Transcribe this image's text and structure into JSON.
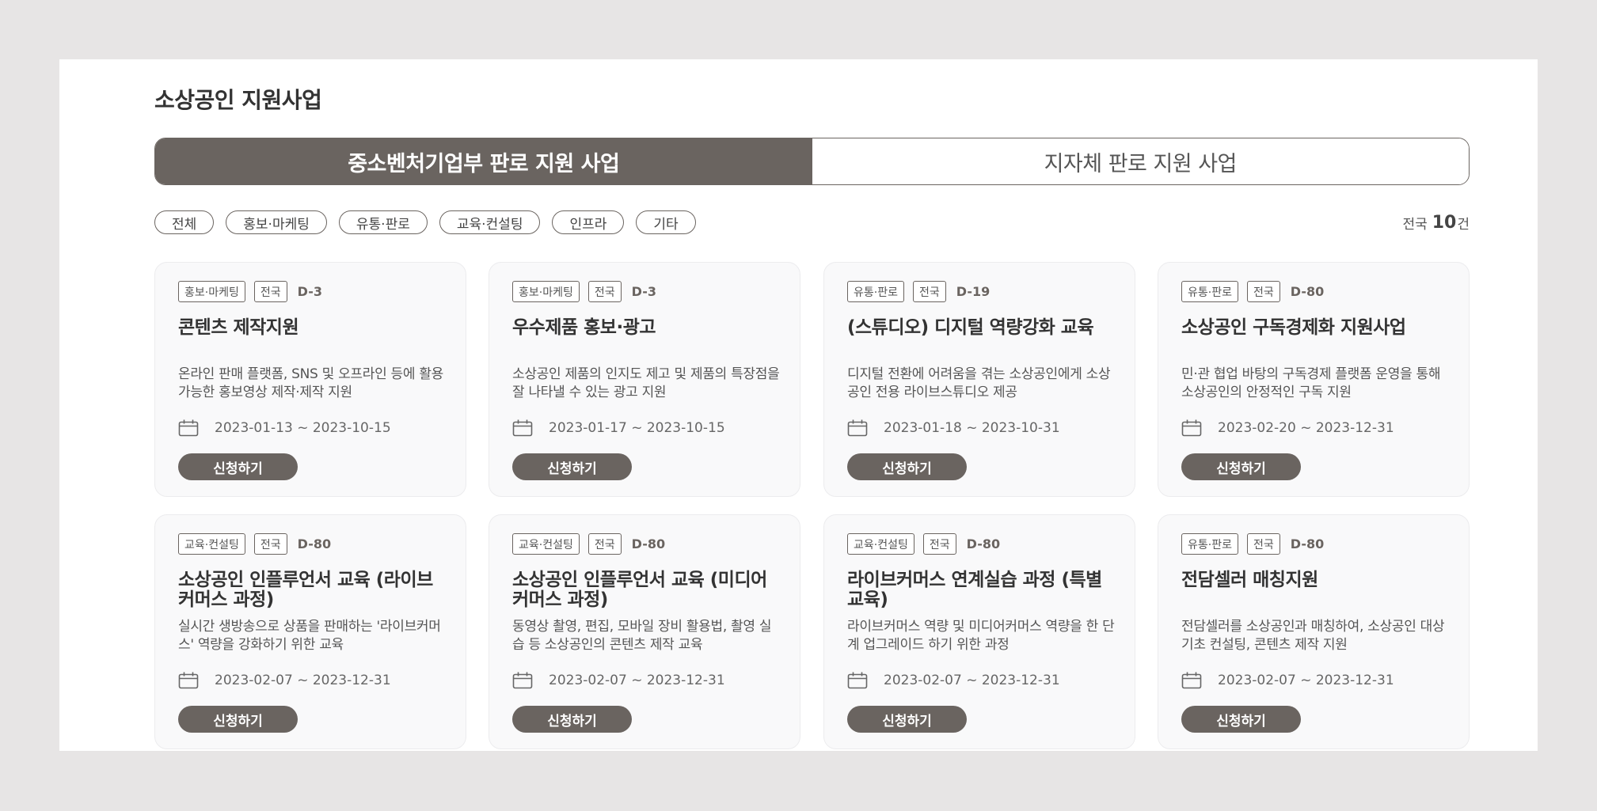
{
  "page": {
    "title": "소상공인 지원사업"
  },
  "tabs": [
    {
      "label": "중소벤처기업부 판로 지원 사업",
      "active": true
    },
    {
      "label": "지자체 판로 지원 사업",
      "active": false
    }
  ],
  "filters": [
    "전체",
    "홍보·마케팅",
    "유통·판로",
    "교육·컨설팅",
    "인프라",
    "기타"
  ],
  "count": {
    "prefix": "전국",
    "number": "10",
    "suffix": "건"
  },
  "apply_label": "신청하기",
  "colors": {
    "accent": "#6a6460",
    "card_bg": "#f9f9fa",
    "page_bg": "#e7e5e5"
  },
  "cards": [
    {
      "category": "홍보·마케팅",
      "region": "전국",
      "dday": "D-3",
      "title": "콘텐츠 제작지원",
      "desc": "온라인 판매 플랫폼, SNS 및 오프라인 등에 활용 가능한 홍보영상 제작·제작 지원",
      "period": "2023-01-13 ~ 2023-10-15"
    },
    {
      "category": "홍보·마케팅",
      "region": "전국",
      "dday": "D-3",
      "title": "우수제품 홍보·광고",
      "desc": "소상공인 제품의 인지도 제고 및 제품의 특장점을 잘 나타낼 수 있는 광고 지원",
      "period": "2023-01-17 ~ 2023-10-15"
    },
    {
      "category": "유통·판로",
      "region": "전국",
      "dday": "D-19",
      "title": "(스튜디오) 디지털 역량강화 교육",
      "desc": "디지털 전환에 어려움을 겪는 소상공인에게 소상공인 전용 라이브스튜디오 제공",
      "period": "2023-01-18 ~ 2023-10-31"
    },
    {
      "category": "유통·판로",
      "region": "전국",
      "dday": "D-80",
      "title": "소상공인 구독경제화 지원사업",
      "desc": "민·관 협업 바탕의 구독경제 플랫폼 운영을 통해 소상공인의 안정적인 구독 지원",
      "period": "2023-02-20 ~ 2023-12-31"
    },
    {
      "category": "교육·컨설팅",
      "region": "전국",
      "dday": "D-80",
      "title": "소상공인 인플루언서 교육 (라이브커머스 과정)",
      "desc": "실시간 생방송으로 상품을 판매하는 '라이브커머스' 역량을 강화하기 위한 교육",
      "period": "2023-02-07 ~ 2023-12-31"
    },
    {
      "category": "교육·컨설팅",
      "region": "전국",
      "dday": "D-80",
      "title": "소상공인 인플루언서 교육 (미디어커머스 과정)",
      "desc": "동영상 촬영, 편집, 모바일 장비 활용법, 촬영 실습 등 소상공인의 콘텐츠 제작 교육",
      "period": "2023-02-07 ~ 2023-12-31"
    },
    {
      "category": "교육·컨설팅",
      "region": "전국",
      "dday": "D-80",
      "title": "라이브커머스 연계실습 과정 (특별교육)",
      "desc": "라이브커머스 역량 및 미디어커머스 역량을 한 단계 업그레이드 하기 위한 과정",
      "period": "2023-02-07 ~ 2023-12-31"
    },
    {
      "category": "유통·판로",
      "region": "전국",
      "dday": "D-80",
      "title": "전담셀러 매칭지원",
      "desc": "전담셀러를 소상공인과 매칭하여, 소상공인 대상 기초 컨설팅, 콘텐츠 제작 지원",
      "period": "2023-02-07 ~ 2023-12-31"
    }
  ]
}
